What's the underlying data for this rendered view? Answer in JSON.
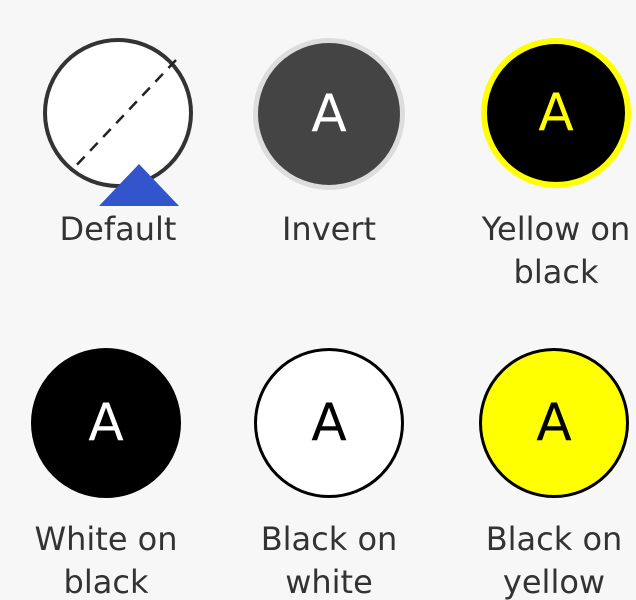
{
  "swatches": [
    {
      "id": "default",
      "label": "Default",
      "glyph": "",
      "selected": true,
      "colors": {
        "background": "#ffffff",
        "border": "#333333",
        "text": "#333333"
      }
    },
    {
      "id": "invert",
      "label": "Invert",
      "glyph": "A",
      "colors": {
        "background": "#444444",
        "border": "#dddddd",
        "text": "#ffffff"
      }
    },
    {
      "id": "yellow-on-black",
      "label": "Yellow on black",
      "glyph": "A",
      "colors": {
        "background": "#000000",
        "border": "#ffff00",
        "text": "#ffff00"
      }
    },
    {
      "id": "white-on-black",
      "label": "White on black",
      "glyph": "A",
      "colors": {
        "background": "#000000",
        "border": "#000000",
        "text": "#ffffff"
      }
    },
    {
      "id": "black-on-white",
      "label": "Black on white",
      "glyph": "A",
      "colors": {
        "background": "#ffffff",
        "border": "#000000",
        "text": "#000000"
      }
    },
    {
      "id": "black-on-yellow",
      "label": "Black on yellow",
      "glyph": "A",
      "colors": {
        "background": "#ffff00",
        "border": "#000000",
        "text": "#000000"
      }
    }
  ],
  "icons": {
    "default_slash": "diagonal-slash-icon",
    "selected_marker": "triangle-up-icon"
  },
  "accent": "#3355cc"
}
